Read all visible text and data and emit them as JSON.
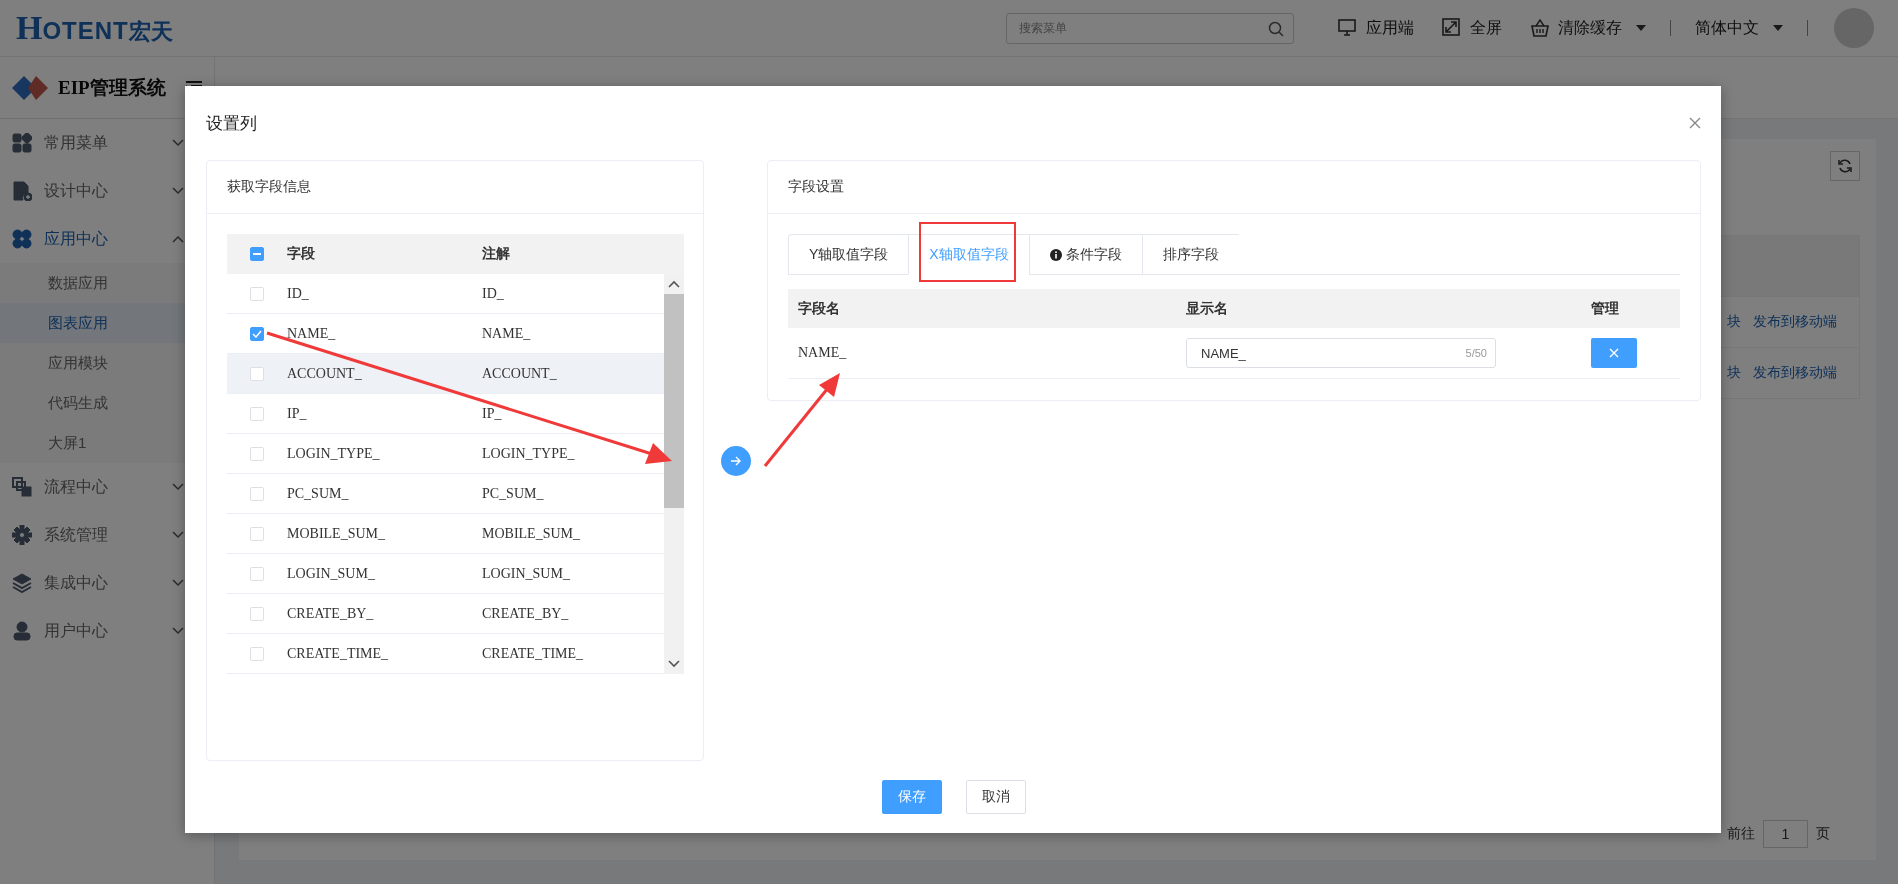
{
  "header": {
    "logo_mark": "H",
    "logo_text": "OTENT",
    "logo_cn": "宏天",
    "search": {
      "placeholder": "搜索菜单"
    },
    "actions": [
      {
        "kind": "monitor",
        "label": "应用端",
        "dropdown": false
      },
      {
        "kind": "fullscreen",
        "label": "全屏",
        "dropdown": false
      },
      {
        "kind": "basket",
        "label": "清除缓存",
        "dropdown": true
      }
    ],
    "language": {
      "label": "简体中文",
      "dropdown": true
    }
  },
  "sidebar": {
    "title": "EIP管理系统",
    "items": [
      {
        "label": "常用菜单",
        "expanded": false,
        "selected": false
      },
      {
        "label": "设计中心",
        "expanded": false,
        "selected": false
      },
      {
        "label": "应用中心",
        "expanded": true,
        "selected": true,
        "children": [
          {
            "label": "数据应用",
            "selected": false
          },
          {
            "label": "图表应用",
            "selected": true
          },
          {
            "label": "应用模块",
            "selected": false
          },
          {
            "label": "代码生成",
            "selected": false
          },
          {
            "label": "大屏1",
            "selected": false
          }
        ]
      },
      {
        "label": "流程中心",
        "expanded": false,
        "selected": false
      },
      {
        "label": "系统管理",
        "expanded": false,
        "selected": false
      },
      {
        "label": "集成中心",
        "expanded": false,
        "selected": false
      },
      {
        "label": "用户中心",
        "expanded": false,
        "selected": false
      }
    ]
  },
  "page": {
    "rows": [
      {
        "links": [
          "块",
          "发布到移动端"
        ]
      },
      {
        "links": [
          "块",
          "发布到移动端"
        ]
      }
    ],
    "pagination": {
      "goto_label": "前往",
      "page": "1",
      "page_suffix": "页"
    }
  },
  "dialog": {
    "title": "设置列",
    "source_panel": {
      "title": "获取字段信息",
      "header_indeterminate": true,
      "columns": [
        "字段",
        "注解"
      ],
      "rows": [
        {
          "field": "ID_",
          "comment": "ID_",
          "checked": false,
          "hovered": false
        },
        {
          "field": "NAME_",
          "comment": "NAME_",
          "checked": true,
          "hovered": false
        },
        {
          "field": "ACCOUNT_",
          "comment": "ACCOUNT_",
          "checked": false,
          "hovered": true
        },
        {
          "field": "IP_",
          "comment": "IP_",
          "checked": false,
          "hovered": false
        },
        {
          "field": "LOGIN_TYPE_",
          "comment": "LOGIN_TYPE_",
          "checked": false,
          "hovered": false
        },
        {
          "field": "PC_SUM_",
          "comment": "PC_SUM_",
          "checked": false,
          "hovered": false
        },
        {
          "field": "MOBILE_SUM_",
          "comment": "MOBILE_SUM_",
          "checked": false,
          "hovered": false
        },
        {
          "field": "LOGIN_SUM_",
          "comment": "LOGIN_SUM_",
          "checked": false,
          "hovered": false
        },
        {
          "field": "CREATE_BY_",
          "comment": "CREATE_BY_",
          "checked": false,
          "hovered": false
        },
        {
          "field": "CREATE_TIME_",
          "comment": "CREATE_TIME_",
          "checked": false,
          "hovered": false
        }
      ]
    },
    "target_panel": {
      "title": "字段设置",
      "tabs": [
        {
          "label": "Y轴取值字段",
          "selected": false,
          "kind": "plain",
          "highlighted": false
        },
        {
          "label": "X轴取值字段",
          "selected": true,
          "kind": "plain",
          "highlighted": true
        },
        {
          "label": "条件字段",
          "selected": false,
          "kind": "info",
          "highlighted": false
        },
        {
          "label": "排序字段",
          "selected": false,
          "kind": "plain",
          "highlighted": false
        }
      ],
      "columns": [
        "字段名",
        "显示名",
        "管理"
      ],
      "rows": [
        {
          "field": "NAME_",
          "display_name": "NAME_",
          "counter": "5/50"
        }
      ]
    },
    "buttons": [
      {
        "kind": "primary",
        "label": "保存"
      },
      {
        "kind": "default",
        "label": "取消"
      }
    ]
  }
}
